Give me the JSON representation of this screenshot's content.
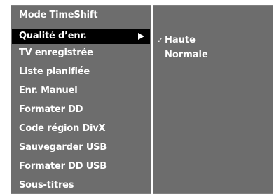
{
  "menu": {
    "items": [
      {
        "label": "Mode TimeShift"
      },
      {
        "label": "Qualité d’enr."
      },
      {
        "label": "TV enregistrée"
      },
      {
        "label": "Liste planifiée"
      },
      {
        "label": "Enr. Manuel"
      },
      {
        "label": "Formater DD"
      },
      {
        "label": "Code région DivX"
      },
      {
        "label": "Sauvegarder USB"
      },
      {
        "label": "Formater DD USB"
      },
      {
        "label": "Sous-titres"
      }
    ],
    "selected_index": 1,
    "submenu_arrow_icon": "triangle-right-icon"
  },
  "submenu": {
    "items": [
      {
        "label": "Haute",
        "checked": true
      },
      {
        "label": "Normale",
        "checked": false
      }
    ],
    "check_mark": "✓",
    "check_icon": "checkmark-icon"
  },
  "colors": {
    "panel": "#6d6d6d",
    "selected_row": "#000000",
    "text": "#ffffff"
  }
}
